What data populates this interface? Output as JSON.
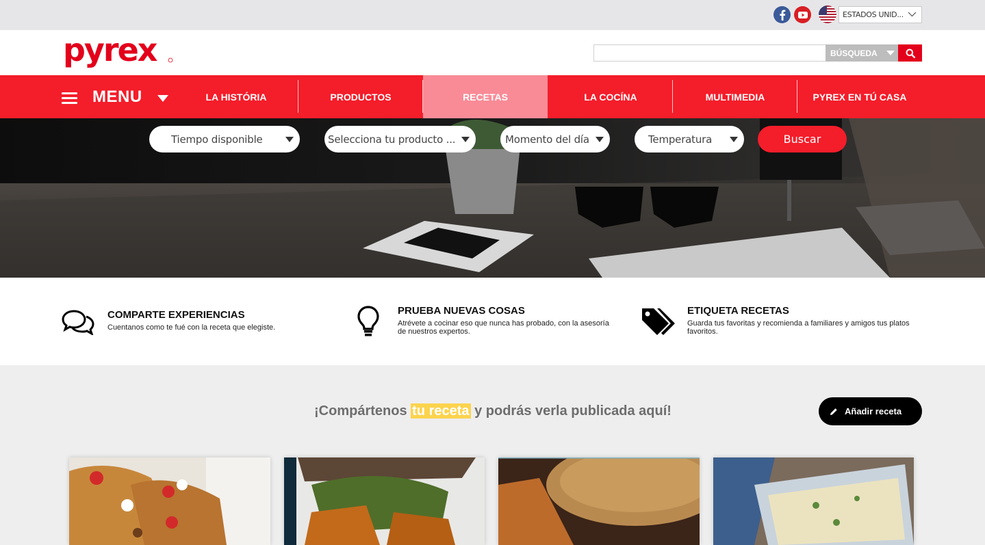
{
  "topbar": {
    "social": [
      {
        "name": "facebook-icon",
        "glyph": "f"
      },
      {
        "name": "youtube-icon",
        "glyph": "▶"
      }
    ],
    "country_selected": "ESTADOS UNID..."
  },
  "header": {
    "logo_text": "pyrex",
    "search_placeholder": "",
    "search_type": "BÚSQUEDA"
  },
  "nav": {
    "menu_label": "MENU",
    "items": [
      {
        "label": "LA HISTÓRIA"
      },
      {
        "label": "PRODUCTOS"
      },
      {
        "label": "RECETAS"
      },
      {
        "label": "LA COCÍNA"
      },
      {
        "label": "MULTIMEDIA"
      },
      {
        "label": "PYREX EN TÚ CASA"
      }
    ]
  },
  "filters": {
    "tiempo": "Tiempo disponible",
    "producto": "Selecciona tu producto ...",
    "momento": "Momento del día",
    "temperatura": "Temperatura",
    "buscar": "Buscar"
  },
  "features": [
    {
      "title": "COMPARTE EXPERIENCIAS",
      "desc": "Cuentanos como te fué con la receta que elegiste.",
      "icon": "chat-bubbles-icon"
    },
    {
      "title": "PRUEBA NUEVAS COSAS",
      "desc": "Atrévete a cocinar eso que nunca has probado, con la asesoría de nuestros expertos.",
      "icon": "lightbulb-icon"
    },
    {
      "title": "ETIQUETA RECETAS",
      "desc": "Guarda tus favoritas y recomienda a familiares y amigos tus platos favoritos.",
      "icon": "tags-icon"
    }
  ],
  "share": {
    "before": "¡Compártenos",
    "highlight": "tu receta",
    "after": "y podrás verla publicada aquí!",
    "add_button": "Añadir receta"
  },
  "colors": {
    "brand_red": "#f41d2a",
    "active_nav": "#f98b97",
    "highlight": "#fcd34d"
  }
}
